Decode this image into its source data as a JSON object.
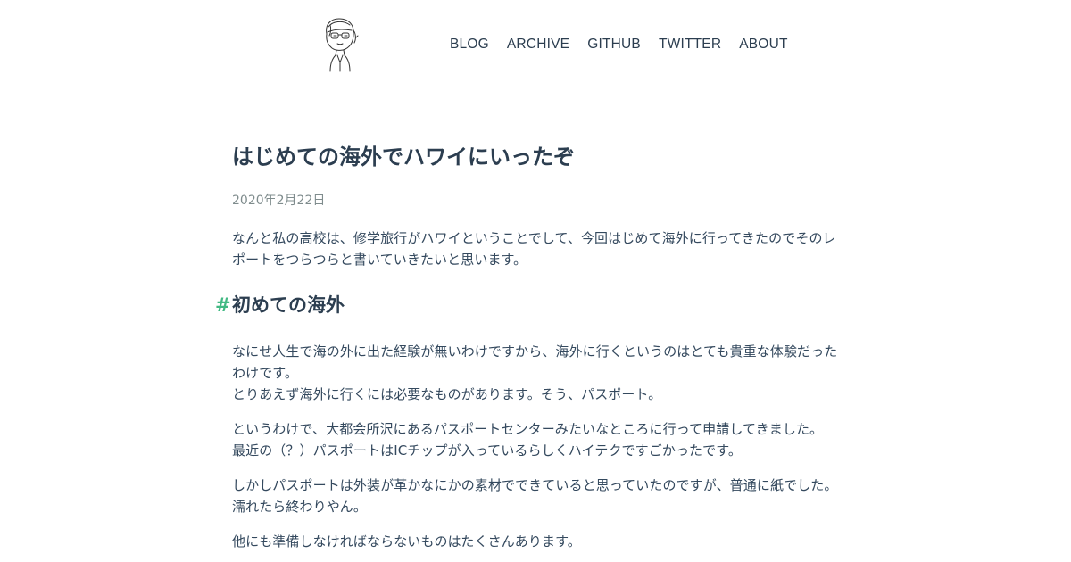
{
  "nav": {
    "items": [
      "BLOG",
      "ARCHIVE",
      "GITHUB",
      "TWITTER",
      "ABOUT"
    ]
  },
  "post": {
    "title": "はじめての海外でハワイにいったぞ",
    "date": "2020年2月22日",
    "intro": [
      "なんと私の高校は、修学旅行がハワイということでして、今回はじめて海外に行ってきたのでそのレ",
      "ポートをつらつらと書いていきたいと思います。"
    ],
    "section": {
      "anchor": "#",
      "heading": "初めての海外"
    },
    "paragraphs": [
      [
        "なにせ人生で海の外に出た経験が無いわけですから、海外に行くというのはとても貴重な体験だった",
        "わけです。",
        "とりあえず海外に行くには必要なものがあります。そう、パスポート。"
      ],
      [
        "というわけで、大都会所沢にあるパスポートセンターみたいなところに行って申請してきました。",
        "最近の（？）パスポートはICチップが入っているらしくハイテクですごかったです。"
      ],
      [
        "しかしパスポートは外装が革かなにかの素材でできていると思っていたのですが、普通に紙でした。",
        "濡れたら終わりやん。"
      ],
      [
        "他にも準備しなければならないものはたくさんあります。"
      ]
    ]
  },
  "colors": {
    "text": "#2c3e50",
    "body_text": "#34495e",
    "muted": "#7f8c8d",
    "accent": "#42b983"
  }
}
